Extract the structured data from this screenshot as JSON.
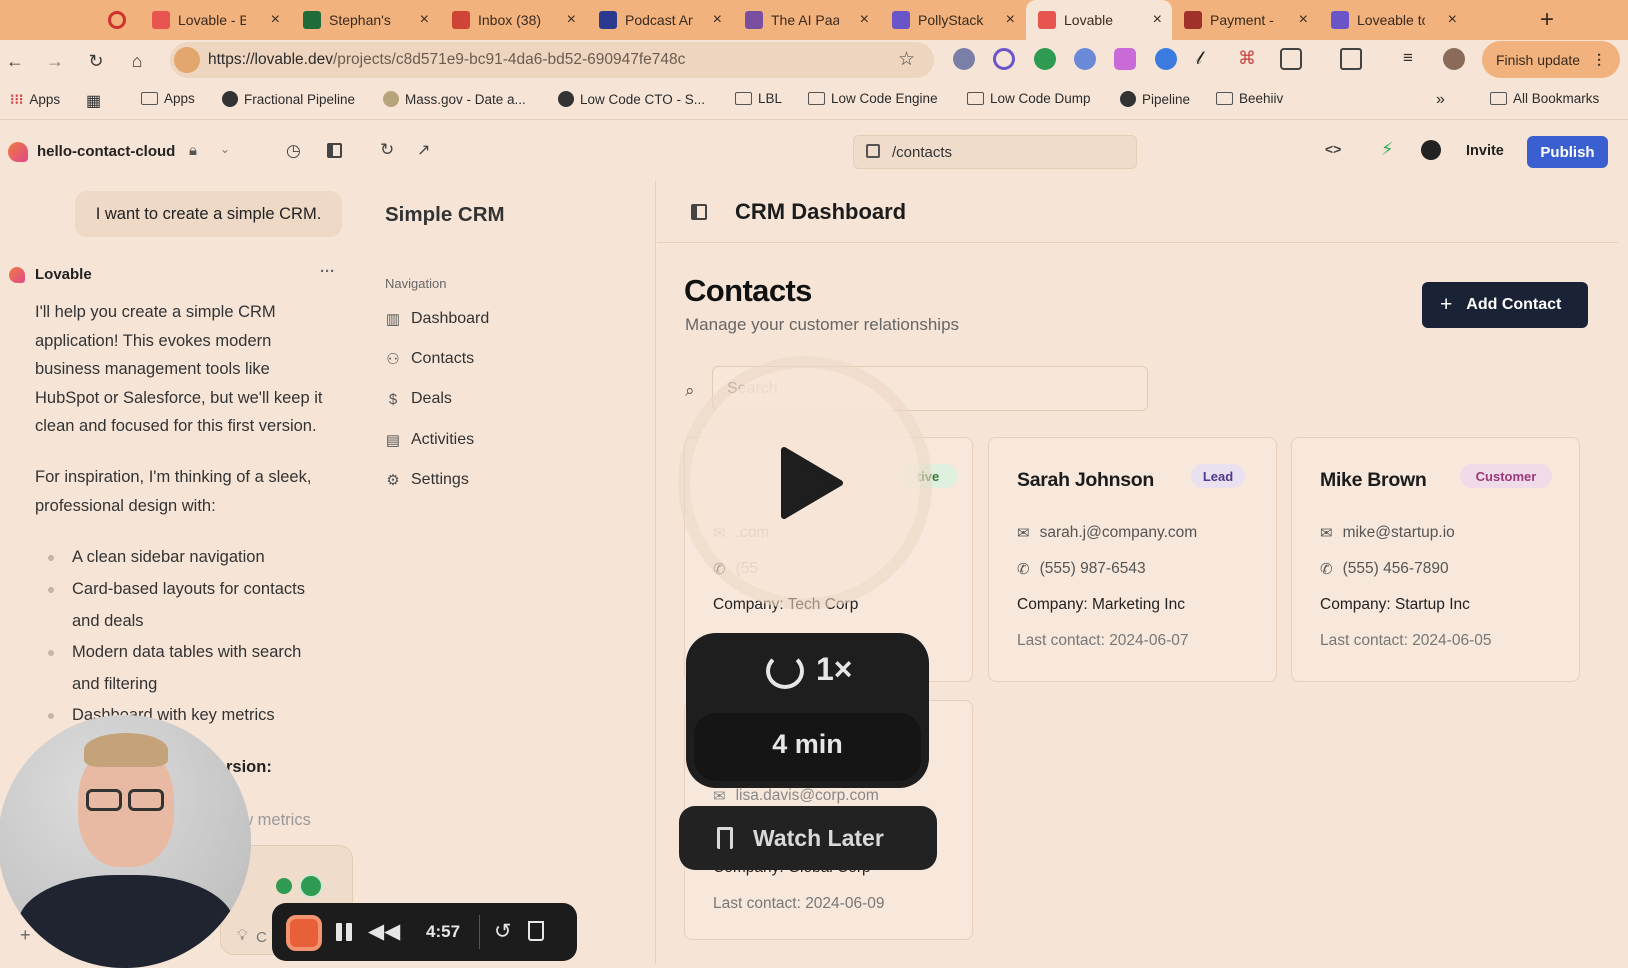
{
  "browser": {
    "tabs": [
      {
        "label": "Lovable - B",
        "fav": "#e8554e"
      },
      {
        "label": "Stephan's",
        "fav": "#1f6b3a"
      },
      {
        "label": "Inbox (38)",
        "fav": "#d04437"
      },
      {
        "label": "Podcast An",
        "fav": "#2a3a8f"
      },
      {
        "label": "The AI Paa",
        "fav": "#7b4fa0"
      },
      {
        "label": "PollyStack",
        "fav": "#6a55c8"
      },
      {
        "label": "Lovable",
        "fav": "#e8554e"
      },
      {
        "label": "Payment -",
        "fav": "#a0302a"
      },
      {
        "label": "Loveable tc",
        "fav": "#6a55c8"
      }
    ],
    "url": "https://lovable.dev/projects/c8d571e9-bc91-4da6-bd52-690947fe748c",
    "url_host": "https://lovable.dev",
    "url_path": "/projects/c8d571e9-bc91-4da6-bd52-690947fe748c",
    "finish_update": "Finish update",
    "bookmarks": [
      {
        "label": "Apps",
        "icon": "apps-grid-icon"
      },
      {
        "label": "Apps",
        "icon": "folder-icon"
      },
      {
        "label": "Fractional Pipeline",
        "icon": "globe-icon"
      },
      {
        "label": "Mass.gov - Date a...",
        "icon": "seal-icon"
      },
      {
        "label": "Low Code CTO - S...",
        "icon": "globe-icon"
      },
      {
        "label": "LBL",
        "icon": "folder-icon"
      },
      {
        "label": "Low Code Engine",
        "icon": "folder-icon"
      },
      {
        "label": "Low Code Dump",
        "icon": "folder-icon"
      },
      {
        "label": "Pipeline",
        "icon": "globe-icon"
      },
      {
        "label": "Beehiiv",
        "icon": "folder-icon"
      }
    ],
    "all_bookmarks": "All Bookmarks"
  },
  "lovable": {
    "project_name": "hello-contact-cloud",
    "preview_path": "/contacts",
    "invite": "Invite",
    "publish": "Publish",
    "accent": "#3a5fd0"
  },
  "chat": {
    "user_message": "I want to create a simple CRM.",
    "assistant_name": "Lovable",
    "more": "···",
    "para1_lines": [
      "I'll help you create a simple CRM",
      "application! This evokes modern",
      "business management tools like",
      "HubSpot or Salesforce, but we'll keep it",
      "clean and focused for this first version."
    ],
    "para2_lines": [
      "For inspiration, I'm thinking of a sleek,",
      "professional design with:"
    ],
    "bullets": [
      [
        "A clean sidebar navigation"
      ],
      [
        "Card-based layouts for contacts",
        "and deals"
      ],
      [
        "Modern data tables with search",
        "and filtering"
      ],
      [
        "Dashboard with key metrics"
      ]
    ],
    "partial_heading": "rsion:",
    "partial_item": "ew metrics",
    "input_partial": "C"
  },
  "app": {
    "brand": "Simple CRM",
    "nav_heading": "Navigation",
    "nav": [
      {
        "label": "Dashboard",
        "icon": "bar-chart-icon"
      },
      {
        "label": "Contacts",
        "icon": "users-icon"
      },
      {
        "label": "Deals",
        "icon": "dollar-icon"
      },
      {
        "label": "Activities",
        "icon": "calendar-icon"
      },
      {
        "label": "Settings",
        "icon": "gear-icon"
      }
    ],
    "header_title": "CRM Dashboard",
    "page_title": "Contacts",
    "page_subtitle": "Manage your customer relationships",
    "add_contact": "Add Contact",
    "search_placeholder": "Search",
    "contacts": [
      {
        "name": "",
        "badge": "tive",
        "email": ".com",
        "phone": "(55",
        "company": "Company: Tech Corp",
        "last_contact": ""
      },
      {
        "name": "Sarah Johnson",
        "badge": "Lead",
        "email": "sarah.j@company.com",
        "phone": "(555) 987-6543",
        "company": "Company: Marketing Inc",
        "last_contact": "Last contact: 2024-06-07"
      },
      {
        "name": "Mike Brown",
        "badge": "Customer",
        "email": "mike@startup.io",
        "phone": "(555) 456-7890",
        "company": "Company: Startup Inc",
        "last_contact": "Last contact: 2024-06-05"
      },
      {
        "name": "",
        "badge": "",
        "email": "lisa.davis@corp.com",
        "phone": "",
        "company": "Company: Global Corp",
        "last_contact": "Last contact: 2024-06-09"
      }
    ],
    "badge_colors": {
      "Lead": "#e9e0f0",
      "Customer": "#f0dbe9"
    }
  },
  "overlay": {
    "speed": "1×",
    "duration": "4 min",
    "watch_later": "Watch Later",
    "timer": "4:57"
  }
}
